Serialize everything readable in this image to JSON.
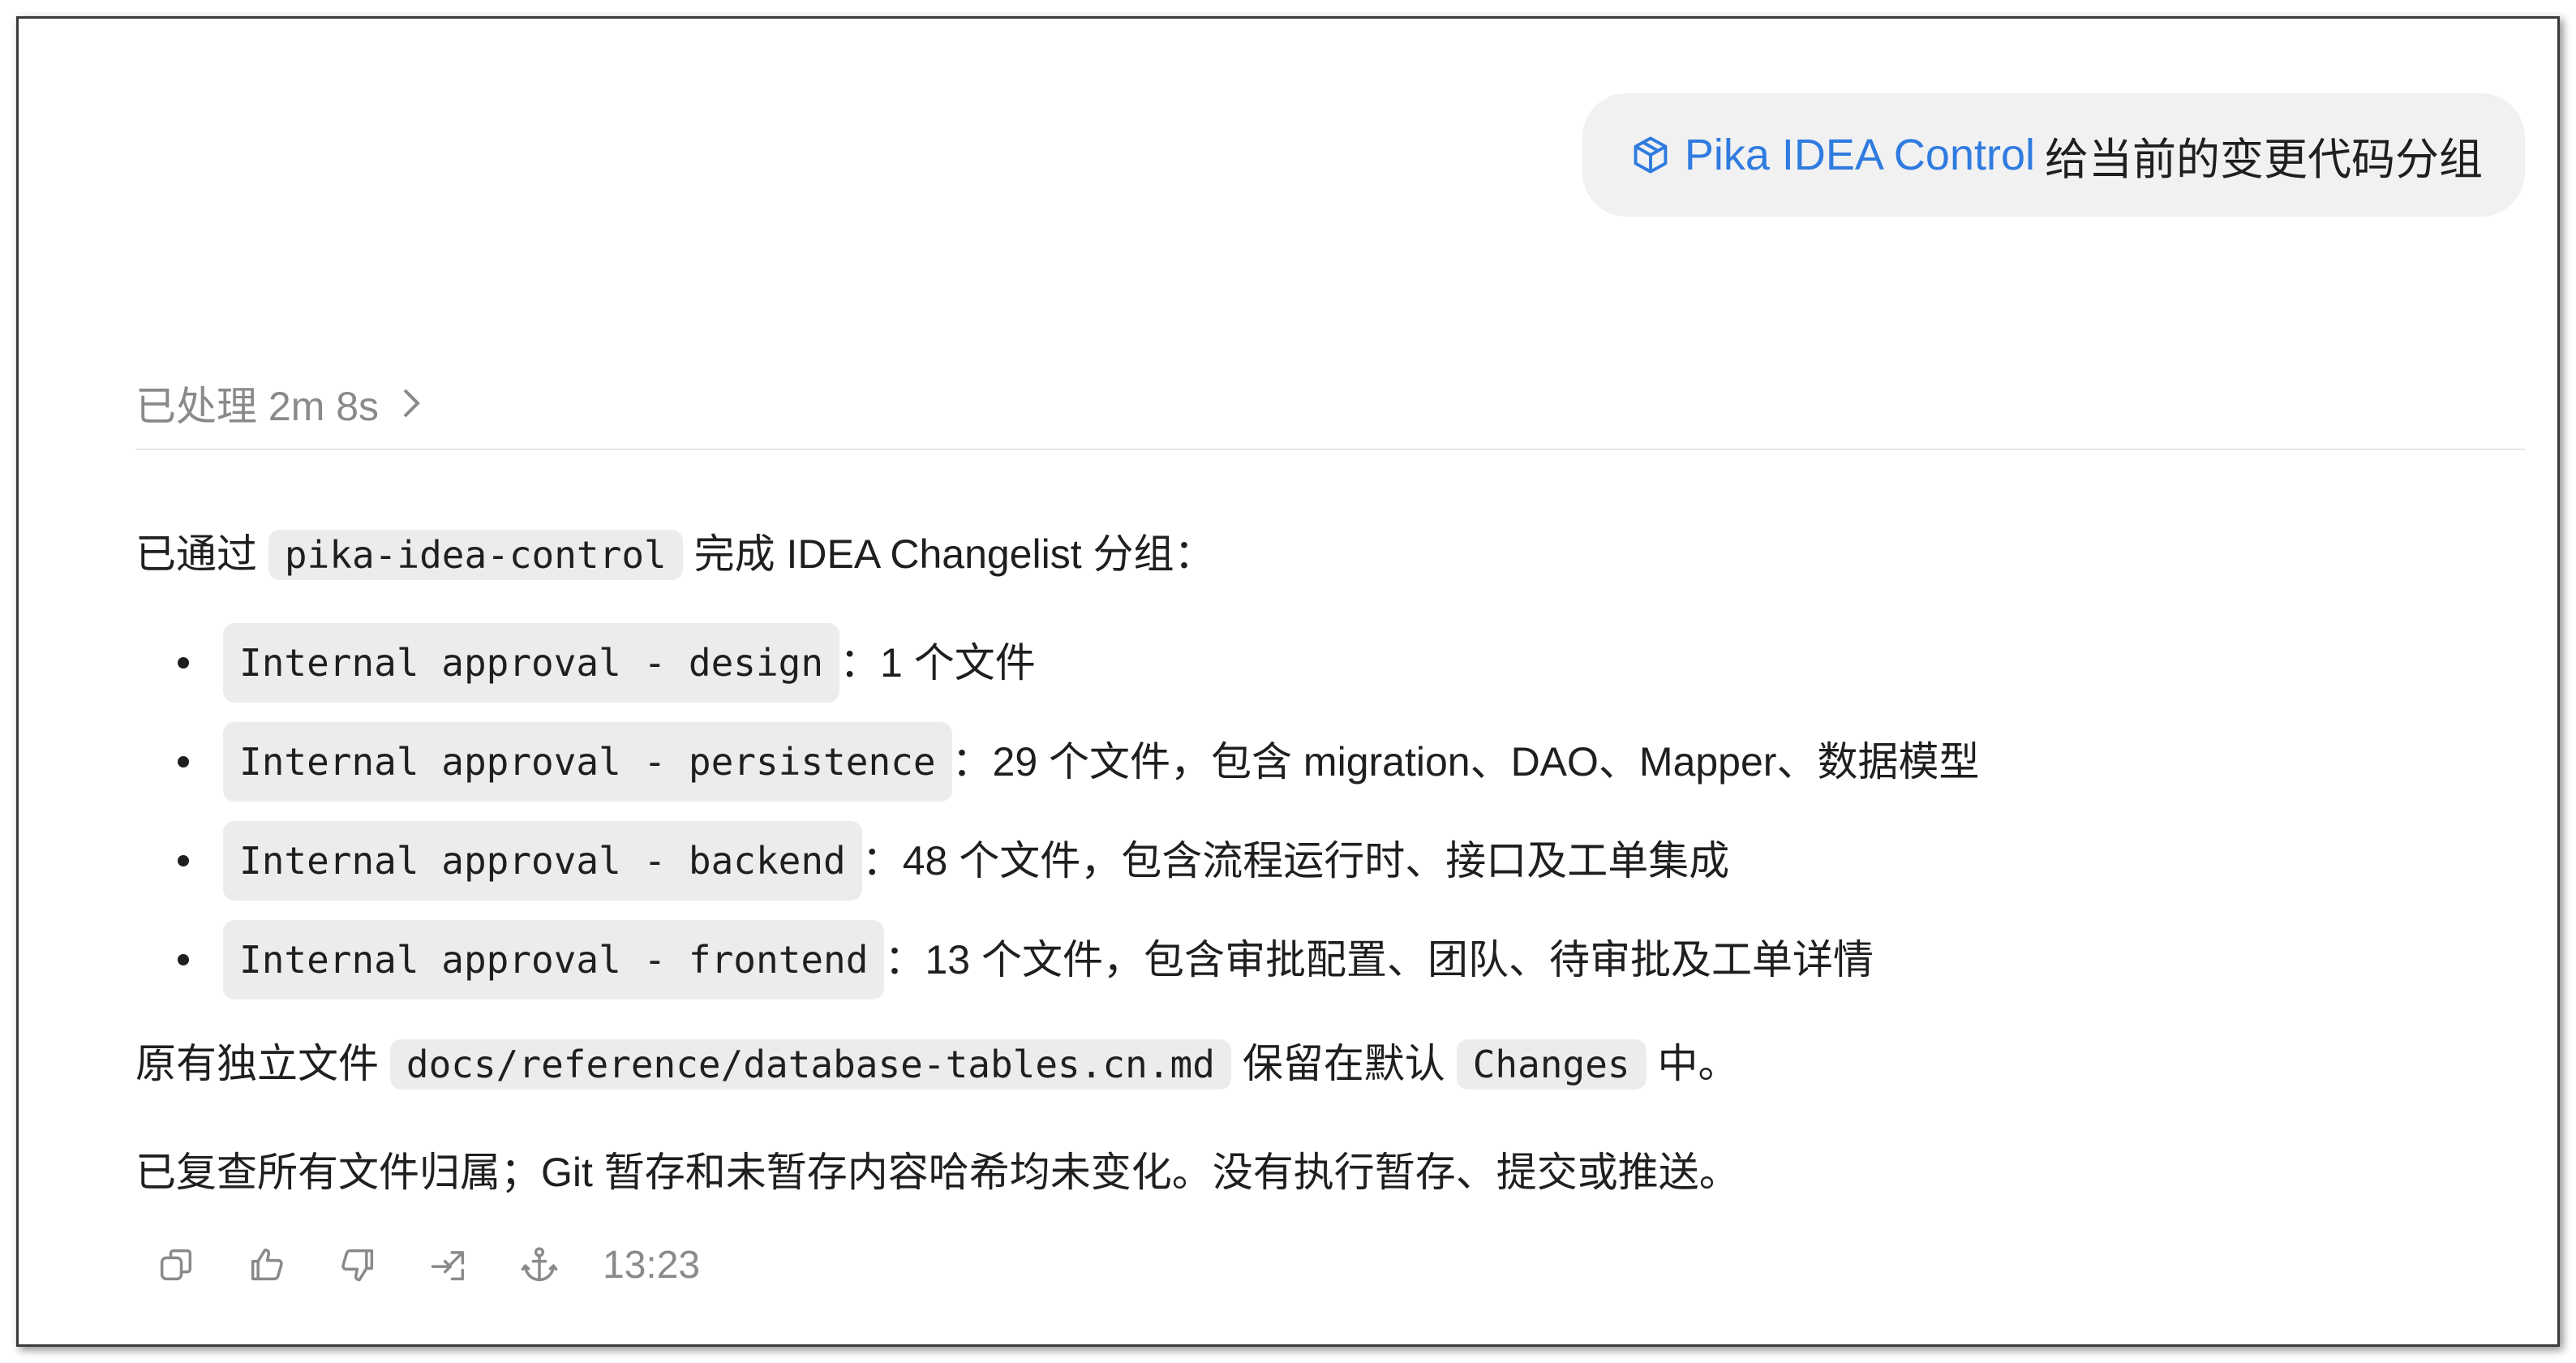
{
  "user_message": {
    "mention_label": "Pika IDEA Control",
    "mention_icon": "cube-icon",
    "text": "给当前的变更代码分组"
  },
  "processing": {
    "label": "已处理 2m 8s",
    "chevron_icon": "chevron-right-icon"
  },
  "response": {
    "intro_before": "已通过",
    "intro_code": "pika-idea-control",
    "intro_after": "完成 IDEA Changelist 分组：",
    "items": [
      {
        "code": "Internal approval - design",
        "text": "：1 个文件"
      },
      {
        "code": "Internal approval - persistence",
        "text": "：29 个文件，包含 migration、DAO、Mapper、数据模型"
      },
      {
        "code": "Internal approval - backend",
        "text": "：48 个文件，包含流程运行时、接口及工单集成"
      },
      {
        "code": "Internal approval - frontend",
        "text": "：13 个文件，包含审批配置、团队、待审批及工单详情"
      }
    ],
    "para2_before": "原有独立文件",
    "para2_code": "docs/reference/database-tables.cn.md",
    "para2_middle": "保留在默认",
    "para2_code2": "Changes",
    "para2_after": "中。",
    "para3": "已复查所有文件归属；Git 暂存和未暂存内容哈希均未变化。没有执行暂存、提交或推送。"
  },
  "actions": {
    "icons": [
      "copy-icon",
      "thumbs-up-icon",
      "thumbs-down-icon",
      "share-icon",
      "anchor-icon"
    ],
    "timestamp": "13:23"
  },
  "colors": {
    "accent": "#2f7be0",
    "muted": "#8a8a8a",
    "bubble_bg": "#f1f1f2",
    "code_bg": "#ececec"
  }
}
